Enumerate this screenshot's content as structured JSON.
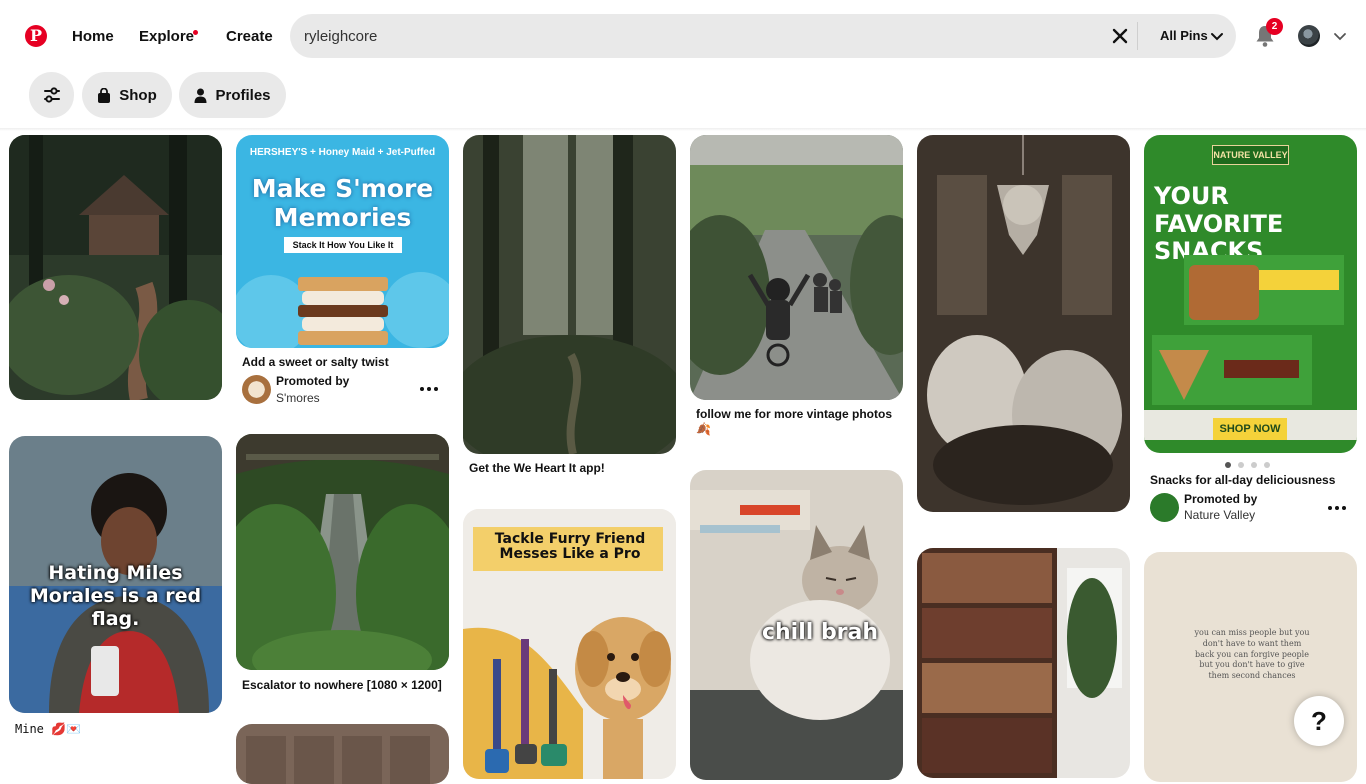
{
  "header": {
    "nav_home": "Home",
    "nav_explore": "Explore",
    "nav_create": "Create",
    "search_value": "ryleighcore",
    "search_scope": "All Pins",
    "notification_count": "2"
  },
  "filters": {
    "shop": "Shop",
    "profiles": "Profiles"
  },
  "pins": {
    "smores": {
      "headline": "Make S'more Memories",
      "subline": "Stack It How You Like It",
      "brands_line": "HERSHEY'S + Honey Maid + Jet-Puffed",
      "title": "Add a sweet or salty twist",
      "promoted": "Promoted by",
      "brand": "S'mores"
    },
    "forest_path": {
      "title": "Get the We Heart It app!"
    },
    "bikes": {
      "title": "follow me for more vintage photos",
      "emoji": "🍂"
    },
    "nature_valley": {
      "logo": "NATURE VALLEY",
      "headline": "YOUR FAVORITE SNACKS",
      "cta": "SHOP NOW",
      "title": "Snacks for all-day deliciousness",
      "promoted": "Promoted by",
      "brand": "Nature Valley"
    },
    "miles": {
      "overlay": "Hating Miles Morales is a red flag.",
      "title": "Mine 💋💌"
    },
    "escalator": {
      "title": "Escalator to nowhere [1080 × 1200]"
    },
    "furry": {
      "headline": "Tackle Furry Friend Messes Like a Pro"
    },
    "cat": {
      "overlay": "chill brah"
    },
    "book_page": {
      "text": "you can miss people but you don't have to want them back you can forgive people but you don't have to give them second chances"
    }
  },
  "help_label": "?",
  "colors": {
    "brand": "#e60023",
    "pill_bg": "#e9e9e9"
  }
}
